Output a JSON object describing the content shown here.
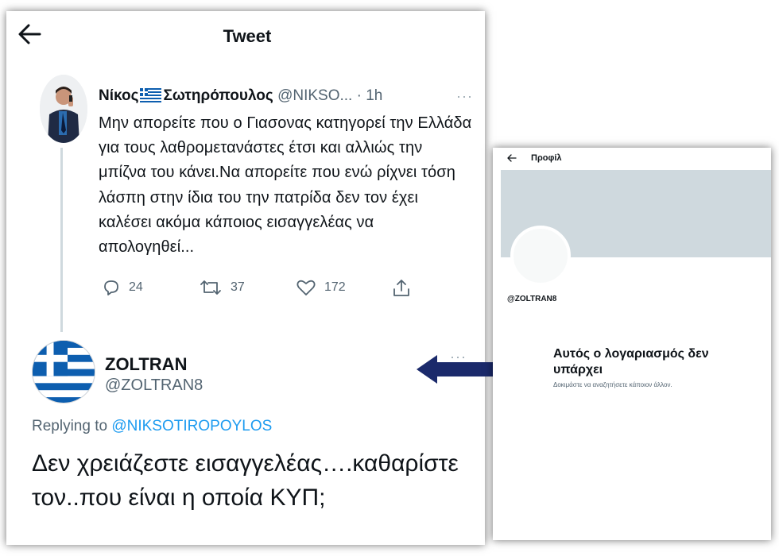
{
  "tweet_screen": {
    "header": {
      "title": "Tweet"
    },
    "original_tweet": {
      "name_part1": "Νίκος",
      "name_part2": "Σωτηρόπουλος",
      "handle": "@NIKSO...",
      "separator": " · ",
      "time": "1h",
      "text": "Μην απορείτε που ο Γιασονας κατηγορεί την Ελλάδα για τους λαθρομετανάστες έτσι και αλλιώς την μπίζνα του κάνει.Να απορείτε που ενώ ρίχνει τόση λάσπη στην ίδια του την πατρίδα δεν τον έχει καλέσει ακόμα κάποιος εισαγγελέας να απολογηθεί...",
      "more": "···",
      "actions": [
        {
          "icon": "reply-icon",
          "count": "24"
        },
        {
          "icon": "retweet-icon",
          "count": "37"
        },
        {
          "icon": "like-icon",
          "count": "172"
        },
        {
          "icon": "share-icon",
          "count": ""
        }
      ]
    },
    "reply_tweet": {
      "name": "ZOLTRAN",
      "handle": "@ZOLTRAN8",
      "more": "···",
      "replying_prefix": "Replying to ",
      "replying_to": "@NIKSOTIROPOYLOS",
      "text": "Δεν χρειάζεστε εισαγγελέας….καθαρίστε τον..που είναι η οποία ΚΥΠ;"
    }
  },
  "profile_screen": {
    "header": {
      "title": "Προφίλ"
    },
    "handle": "@ZOLTRAN8",
    "message": "Αυτός ο λογαριασμός δεν υπάρχει",
    "subtext": "Δοκιμάστε να αναζητήσετε κάποιον άλλον."
  },
  "colors": {
    "text_primary": "#0f1419",
    "text_secondary": "#536471",
    "link_blue": "#1d9bf0",
    "banner_gray": "#cfd9de",
    "arrow_navy": "#1b2a6b",
    "greek_flag_blue": "#0d5eaf"
  }
}
